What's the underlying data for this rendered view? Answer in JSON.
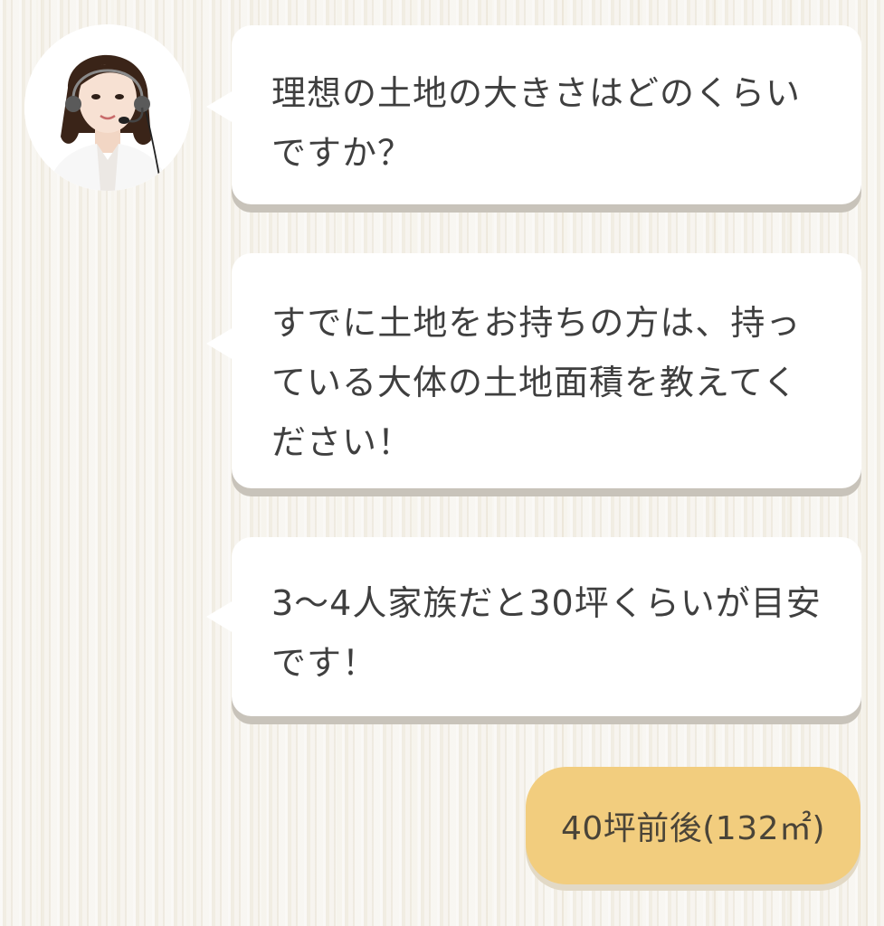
{
  "operator": {
    "avatar_icon": "operator-headset-avatar"
  },
  "messages": [
    {
      "line1": "理想の土地の大きさはどのくらい",
      "line2": "ですか？"
    },
    {
      "line1": "すでに土地をお持ちの方は、持っ",
      "line2": "ている大体の土地面積を教えてく",
      "line3": "ださい！"
    },
    {
      "line1": "3〜4人家族だと30坪くらいが目安",
      "line2": "です！"
    }
  ],
  "reply": {
    "label": "40坪前後(132㎡)"
  },
  "colors": {
    "bubble": "#ffffff",
    "reply": "#f2cd7e",
    "text": "#3f3f3f"
  }
}
